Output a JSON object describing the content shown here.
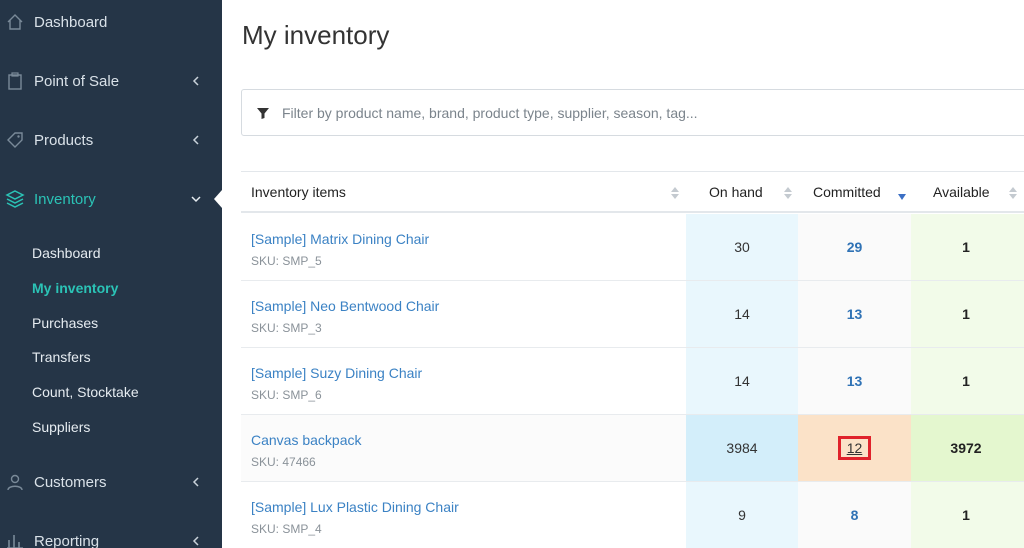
{
  "sidebar": {
    "top_items": [
      {
        "label": "Dashboard",
        "icon": "home-icon"
      },
      {
        "label": "Point of Sale",
        "icon": "clipboard-icon"
      },
      {
        "label": "Products",
        "icon": "tag-icon"
      },
      {
        "label": "Inventory",
        "icon": "layers-icon"
      }
    ],
    "sub_items": [
      {
        "label": "Dashboard"
      },
      {
        "label": "My inventory"
      },
      {
        "label": "Purchases"
      },
      {
        "label": "Transfers"
      },
      {
        "label": "Count, Stocktake"
      },
      {
        "label": "Suppliers"
      }
    ],
    "bottom_items": [
      {
        "label": "Customers",
        "icon": "users-icon"
      },
      {
        "label": "Reporting",
        "icon": "bar-chart-icon"
      }
    ],
    "colors": {
      "background": "#253547",
      "accent": "#2bc3b6"
    }
  },
  "main": {
    "title": "My inventory",
    "filter": {
      "placeholder": "Filter by product name, brand, product type, supplier, season, tag...",
      "value": ""
    }
  },
  "table": {
    "headers": {
      "item": "Inventory items",
      "on_hand": "On hand",
      "committed": "Committed",
      "available": "Available"
    },
    "sorted_by": "committed",
    "rows": [
      {
        "name": "[Sample] Matrix Dining Chair",
        "sku": "SKU: SMP_5",
        "on_hand": "30",
        "committed": "29",
        "available": "1"
      },
      {
        "name": "[Sample] Neo Bentwood Chair",
        "sku": "SKU: SMP_3",
        "on_hand": "14",
        "committed": "13",
        "available": "1"
      },
      {
        "name": "[Sample] Suzy Dining Chair",
        "sku": "SKU: SMP_6",
        "on_hand": "14",
        "committed": "13",
        "available": "1"
      },
      {
        "name": "Canvas backpack",
        "sku": "SKU: 47466",
        "on_hand": "3984",
        "committed": "12",
        "available": "3972"
      },
      {
        "name": "[Sample] Lux Plastic Dining Chair",
        "sku": "SKU: SMP_4",
        "on_hand": "9",
        "committed": "8",
        "available": "1"
      }
    ]
  }
}
